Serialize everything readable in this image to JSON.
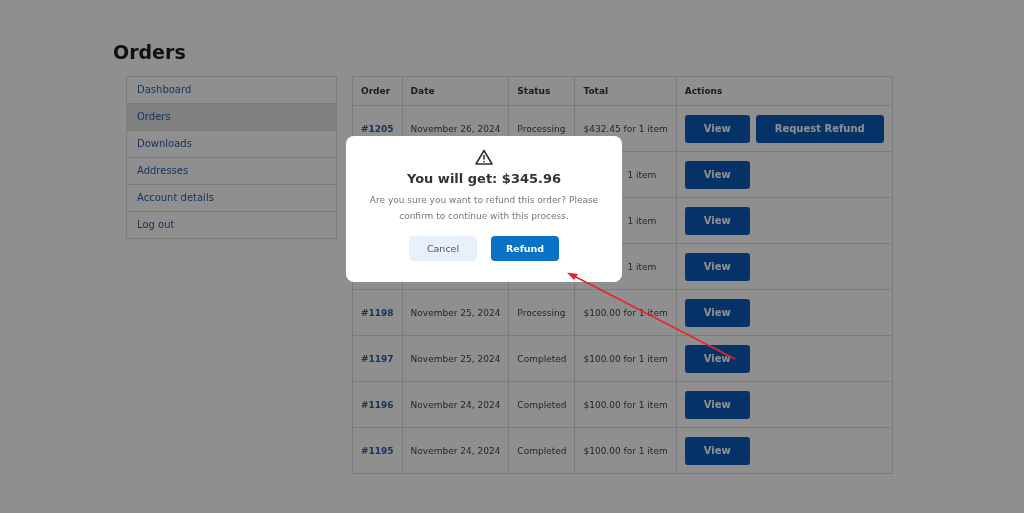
{
  "page_title": "Orders",
  "sidebar": {
    "items": [
      {
        "label": "Dashboard",
        "selected": false
      },
      {
        "label": "Orders",
        "selected": true
      },
      {
        "label": "Downloads",
        "selected": false
      },
      {
        "label": "Addresses",
        "selected": false
      },
      {
        "label": "Account details",
        "selected": false
      },
      {
        "label": "Log out",
        "selected": false
      }
    ]
  },
  "table": {
    "columns": [
      "Order",
      "Date",
      "Status",
      "Total",
      "Actions"
    ],
    "rows": [
      {
        "order": "#1205",
        "date": "November 26, 2024",
        "status": "Processing",
        "total": "$432.45 for 1 item",
        "actions": [
          "View",
          "Request Refund"
        ]
      },
      {
        "total": "1 item",
        "actions": [
          "View"
        ]
      },
      {
        "total": "1 item",
        "actions": [
          "View"
        ]
      },
      {
        "total": "1 item",
        "actions": [
          "View"
        ]
      },
      {
        "order": "#1198",
        "date": "November 25, 2024",
        "status": "Processing",
        "total": "$100.00 for 1 item",
        "actions": [
          "View"
        ]
      },
      {
        "order": "#1197",
        "date": "November 25, 2024",
        "status": "Completed",
        "total": "$100.00 for 1 item",
        "actions": [
          "View"
        ]
      },
      {
        "order": "#1196",
        "date": "November 24, 2024",
        "status": "Completed",
        "total": "$100.00 for 1 item",
        "actions": [
          "View"
        ]
      },
      {
        "order": "#1195",
        "date": "November 24, 2024",
        "status": "Completed",
        "total": "$100.00 for 1 item",
        "actions": [
          "View"
        ]
      }
    ]
  },
  "dialog": {
    "title": "You will get: $345.96",
    "message": "Are you sure you want to refund this order? Please confirm to continue with this process.",
    "buttons": [
      {
        "label": "Cancel",
        "kind": "secondary"
      },
      {
        "label": "Refund",
        "kind": "primary"
      }
    ]
  }
}
